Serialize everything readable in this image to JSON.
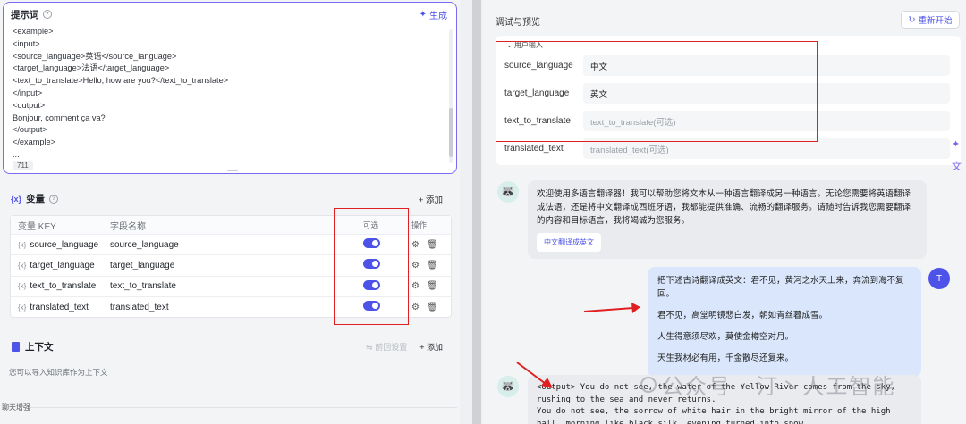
{
  "prompt": {
    "title": "提示词",
    "generate_label": "生成",
    "lines": [
      "<example>",
      "<input>",
      "<source_language>英语</source_language>",
      "<target_language>法语</target_language>",
      "<text_to_translate>Hello, how are you?</text_to_translate>",
      "</input>",
      "<output>",
      "Bonjour, comment ça va?",
      "</output>",
      "</example>",
      "..."
    ],
    "char_count": "711"
  },
  "variables": {
    "title": "变量",
    "add_label": "+ 添加",
    "headers": {
      "key": "变量 KEY",
      "name": "字段名称",
      "optional": "可选",
      "actions": "操作"
    },
    "rows": [
      {
        "key": "source_language",
        "name": "source_language",
        "optional": true
      },
      {
        "key": "target_language",
        "name": "target_language",
        "optional": true
      },
      {
        "key": "text_to_translate",
        "name": "text_to_translate",
        "optional": true
      },
      {
        "key": "translated_text",
        "name": "translated_text",
        "optional": true
      }
    ]
  },
  "context": {
    "title": "上下文",
    "reset_label": "前回设置",
    "add_label": "+ 添加",
    "hint": "您可以导入知识库作为上下文"
  },
  "bottom_label": "聊天增强",
  "preview": {
    "title": "调试与预览",
    "restart_label": "重新开始",
    "user_input_legend": "用户输入",
    "fields": [
      {
        "label": "source_language",
        "value": "中文",
        "placeholder": false
      },
      {
        "label": "target_language",
        "value": "英文",
        "placeholder": false
      },
      {
        "label": "text_to_translate",
        "value": "text_to_translate(可选)",
        "placeholder": true
      },
      {
        "label": "translated_text",
        "value": "translated_text(可选)",
        "placeholder": true
      }
    ]
  },
  "chat": {
    "bot_welcome": "欢迎使用多语言翻译器！我可以帮助您将文本从一种语言翻译成另一种语言。无论您需要将英语翻译成法语，还是将中文翻译成西班牙语，我都能提供准确、流畅的翻译服务。请随时告诉我您需要翻译的内容和目标语言，我将竭诚为您服务。",
    "suggestion_chip": "中文翻译成英文",
    "user_avatar": "T",
    "user_lines": [
      "把下述古诗翻译成英文：君不见，黄河之水天上来，奔流到海不复回。",
      "君不见，高堂明镜悲白发，朝如青丝暮成雪。",
      "人生得意须尽欢，莫使金樽空对月。",
      "天生我材必有用，千金散尽还复来。"
    ],
    "bot_output_line1": "<output> You do not see, the water of the Yellow River comes from the sky, rushing to the sea and never returns.",
    "bot_output_line2": "You do not see, the sorrow of white hair in the bright mirror of the high hall, morning like black silk, evening turned into snow."
  },
  "watermark": "公众号 · 汀丶人工智能",
  "colors": {
    "accent": "#4d53e8",
    "annotation_red": "#e02020"
  }
}
